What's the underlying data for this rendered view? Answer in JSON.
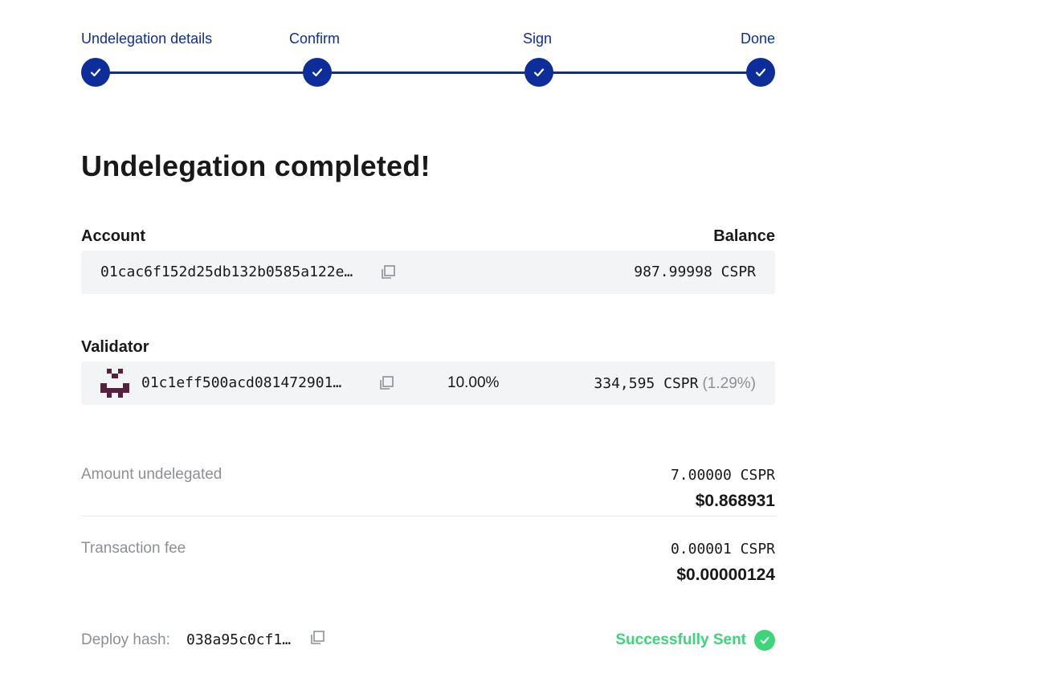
{
  "stepper": {
    "steps": [
      {
        "label": "Undelegation details",
        "state": "completed"
      },
      {
        "label": "Confirm",
        "state": "completed"
      },
      {
        "label": "Sign",
        "state": "completed"
      },
      {
        "label": "Done",
        "state": "completed"
      }
    ],
    "accent_color": "#0d2e9a",
    "dot_icon": "check-icon"
  },
  "title": "Undelegation completed!",
  "account": {
    "label": "Account",
    "balance_label": "Balance",
    "public_key": "01cac6f152d25db132b0585a122e…",
    "balance": "987.99998 CSPR",
    "copy_icon": "copy-icon"
  },
  "validator": {
    "label": "Validator",
    "avatar_icon": "identicon-avatar",
    "avatar_color": "#5a1f3c",
    "public_key": "01c1eff500acd081472901…",
    "commission": "10.00%",
    "stake": "334,595 CSPR",
    "stake_share": "(1.29%)",
    "copy_icon": "copy-icon"
  },
  "amount": {
    "label": "Amount undelegated",
    "cspr": "7.00000 CSPR",
    "usd": "$0.868931"
  },
  "fee": {
    "label": "Transaction fee",
    "cspr": "0.00001 CSPR",
    "usd": "$0.00000124"
  },
  "deploy": {
    "label": "Deploy hash:",
    "hash": "038a95c0cf1…",
    "copy_icon": "copy-icon",
    "status": "Successfully Sent",
    "status_color": "#3ed47a",
    "status_icon": "check-circle-icon"
  }
}
